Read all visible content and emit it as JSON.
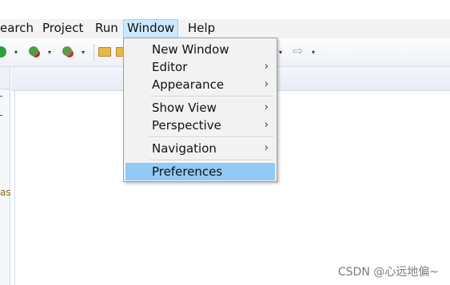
{
  "menubar": {
    "items": [
      "earch",
      "Project",
      "Run",
      "Window",
      "Help"
    ],
    "active": "Window"
  },
  "toolbar": {
    "icons": [
      "run-icon",
      "debug-icon",
      "external-tool-icon",
      "open-folder-icon",
      "forward-icon"
    ],
    "forward_glyph": "⇨",
    "dropdown_glyph": "▾"
  },
  "leftpanel": {
    "fragment": "as"
  },
  "window_menu": {
    "items": [
      {
        "label": "New Window",
        "submenu": false
      },
      {
        "label": "Editor",
        "submenu": true
      },
      {
        "label": "Appearance",
        "submenu": true
      },
      {
        "label": "Show View",
        "submenu": true
      },
      {
        "label": "Perspective",
        "submenu": true
      },
      {
        "label": "Navigation",
        "submenu": true
      },
      {
        "label": "Preferences",
        "submenu": false
      }
    ],
    "highlighted": "Preferences",
    "submenu_arrow": "›"
  },
  "watermark": "CSDN @心远地偏~",
  "colors": {
    "menu_active_bg": "#cce8ff",
    "menu_highlight_bg": "#91c9f7",
    "dropdown_bg": "#f2f2f2"
  }
}
